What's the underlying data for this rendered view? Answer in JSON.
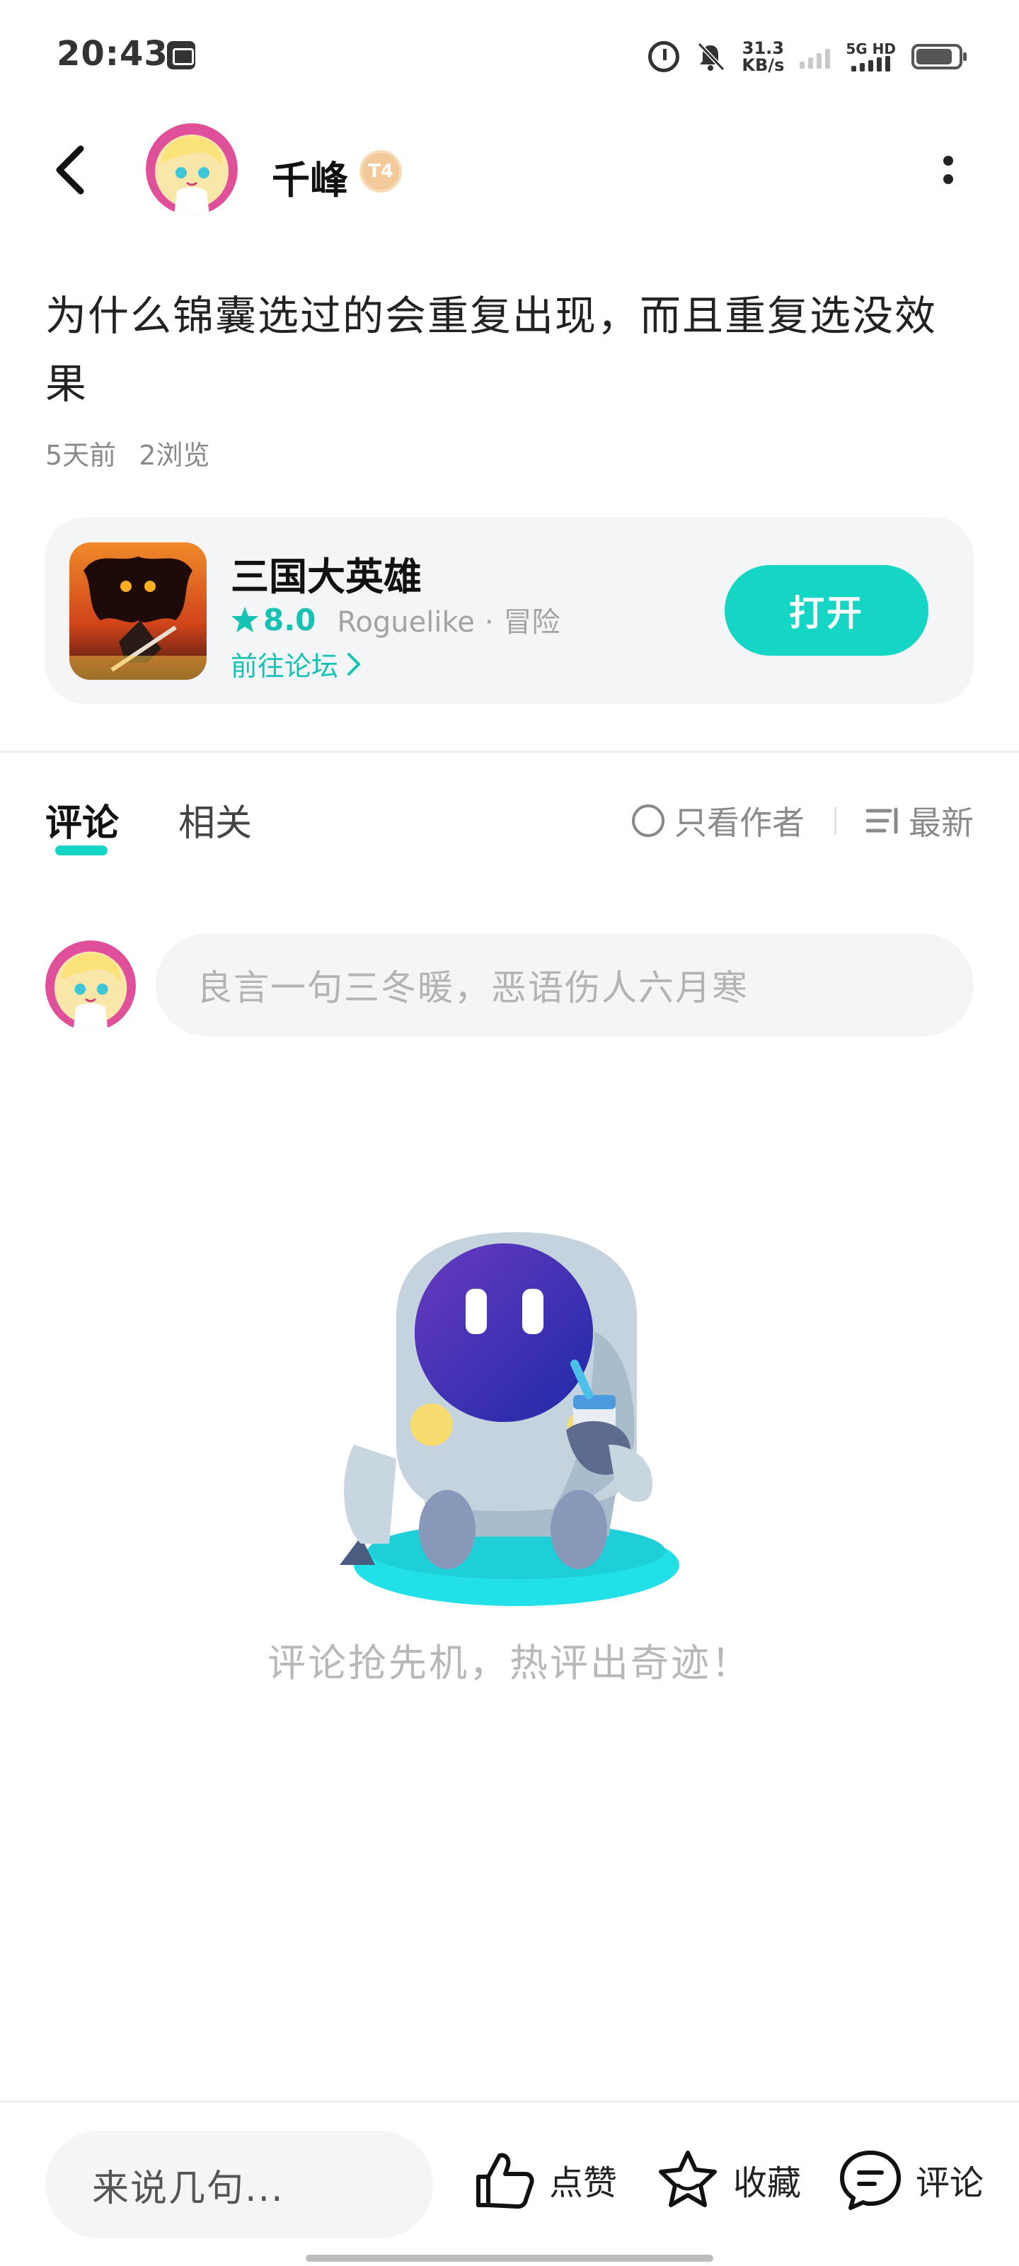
{
  "status_bar": {
    "time": "20:43",
    "net_speed_value": "31.3",
    "net_speed_unit": "KB/s",
    "network": "5G HD",
    "battery_level_percent": 75
  },
  "header": {
    "author_name": "千峰",
    "level_badge": "T4"
  },
  "post": {
    "title": "为什么锦囊选过的会重复出现，而且重复选没效果",
    "time_ago": "5天前",
    "views": "2浏览"
  },
  "game_card": {
    "name": "三国大英雄",
    "rating": "8.0",
    "genre": "Roguelike",
    "category": "冒险",
    "forum_link": "前往论坛",
    "open_button": "打开"
  },
  "tabs": {
    "items": [
      {
        "label": "评论",
        "active": true
      },
      {
        "label": "相关",
        "active": false
      }
    ],
    "author_only": "只看作者",
    "sort": "最新"
  },
  "comment_input": {
    "placeholder": "良言一句三冬暖，恶语伤人六月寒"
  },
  "empty_state": {
    "message": "评论抢先机，热评出奇迹！"
  },
  "bottom_bar": {
    "input_placeholder": "来说几句...",
    "like_label": "点赞",
    "favorite_label": "收藏",
    "comment_label": "评论"
  },
  "colors": {
    "accent": "#15d5c4",
    "accent_text": "#16c2b4",
    "avatar_ring": "#e0509a"
  },
  "icons": [
    "alarm-icon",
    "bell-off-icon",
    "signal-icon",
    "battery-icon",
    "back-arrow-icon",
    "more-icon",
    "star-icon",
    "chevron-right-icon",
    "radio-icon",
    "sort-icon",
    "thumbs-up-icon",
    "star-outline-icon",
    "chat-bubble-icon"
  ]
}
